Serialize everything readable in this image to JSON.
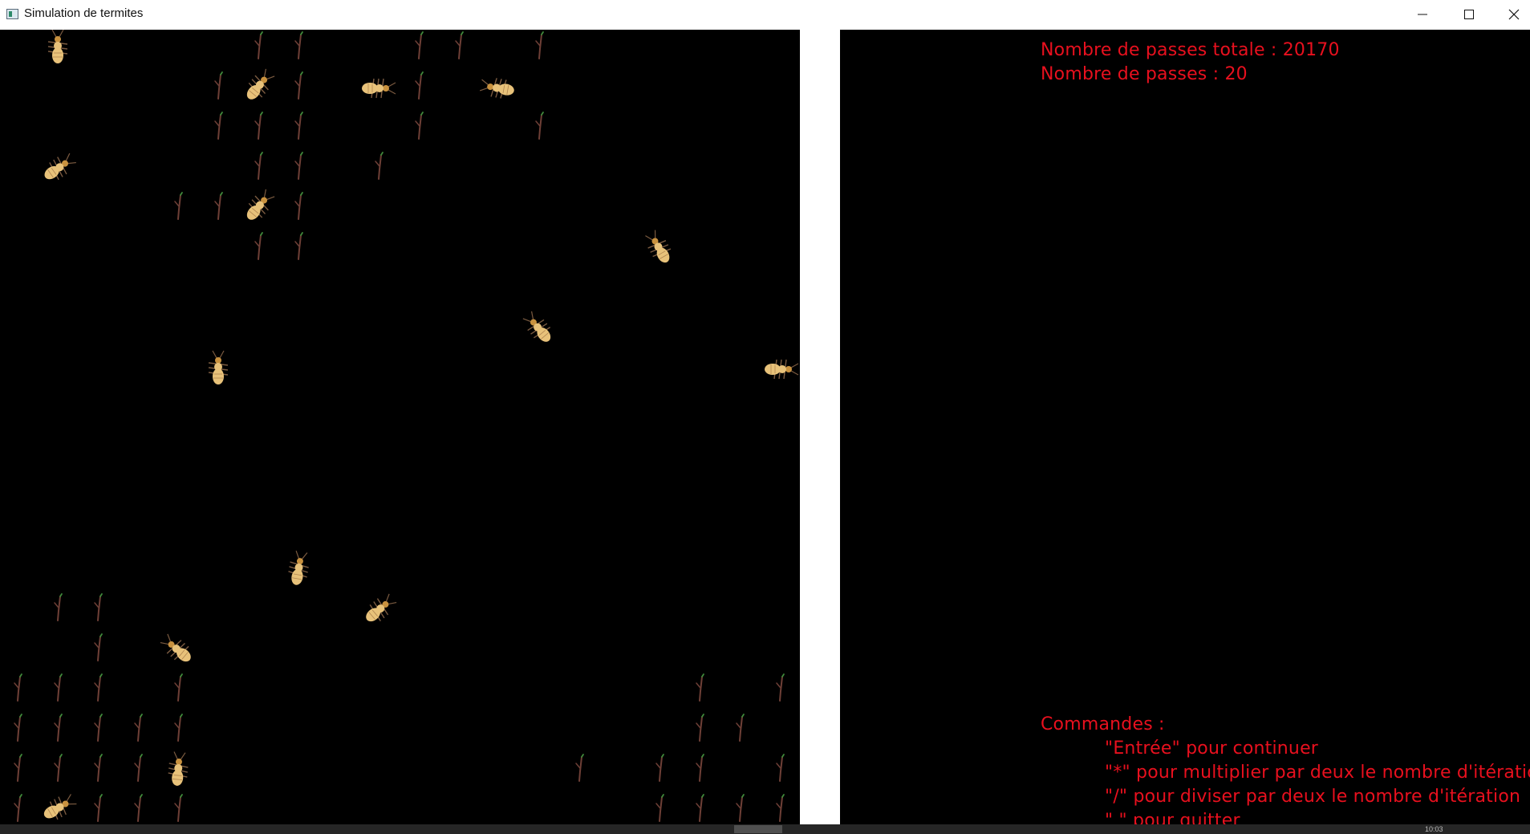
{
  "window": {
    "title": "Simulation de termites",
    "controls": [
      "minimize-icon",
      "maximize-icon",
      "close-icon"
    ]
  },
  "info_panel": {
    "total_passes_line": "Nombre de passes totale : 20170",
    "passes_line": "Nombre de passes : 20",
    "commands_header": "Commandes :",
    "commands": [
      "\"Entrée\" pour continuer",
      "\"*\" pour multiplier par deux le nombre d'itération",
      "\"/\" pour diviser par deux le nombre d'itération",
      "\" \" pour quitter"
    ]
  },
  "colors": {
    "background": "#000000",
    "text": "#e8101e",
    "termite_body": "#e8c27a",
    "termite_legs": "#7a5a40",
    "twig": "#6e3f36",
    "twig_leaf": "#3f8a3a"
  },
  "taskbar": {
    "clock_hint": "10:03"
  }
}
